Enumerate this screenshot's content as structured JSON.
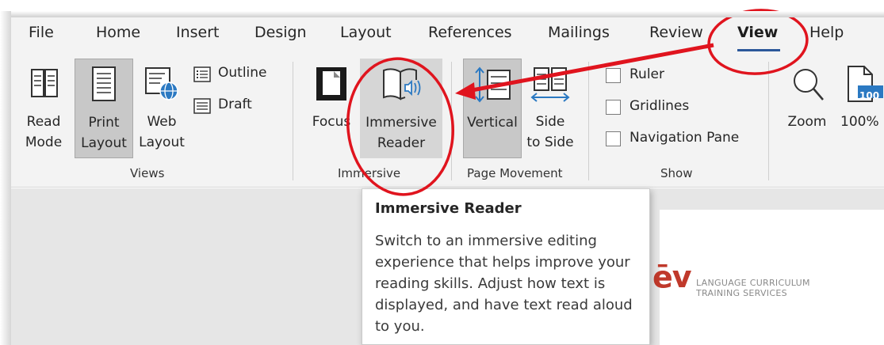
{
  "tabs": [
    "File",
    "Home",
    "Insert",
    "Design",
    "Layout",
    "References",
    "Mailings",
    "Review",
    "View",
    "Help"
  ],
  "active_tab": "View",
  "views": {
    "read_mode": [
      "Read",
      "Mode"
    ],
    "print_layout": [
      "Print",
      "Layout"
    ],
    "web_layout": [
      "Web",
      "Layout"
    ],
    "outline": "Outline",
    "draft": "Draft",
    "label": "Views"
  },
  "immersive": {
    "focus": "Focus",
    "immersive_reader": [
      "Immersive",
      "Reader"
    ],
    "label": "Immersive"
  },
  "page_movement": {
    "vertical": "Vertical",
    "side_to_side": [
      "Side",
      "to Side"
    ],
    "label": "Page Movement"
  },
  "show": {
    "ruler": "Ruler",
    "gridlines": "Gridlines",
    "navigation_pane": "Navigation Pane",
    "label": "Show"
  },
  "zoom": {
    "zoom": "Zoom",
    "percent": "100%",
    "icon_badge": "100"
  },
  "tooltip": {
    "title": "Immersive Reader",
    "body": "Switch to an immersive editing experience that helps improve your reading skills. Adjust how text is displayed, and have text read aloud to you."
  },
  "document": {
    "logo_mark": "ēv",
    "logo_line1": "LANGUAGE CURRICULUM",
    "logo_line2": "TRAINING SERVICES"
  },
  "colors": {
    "accent": "#2b579a",
    "annotation_red": "#e0141e",
    "selected_button": "#c8c8c8"
  }
}
